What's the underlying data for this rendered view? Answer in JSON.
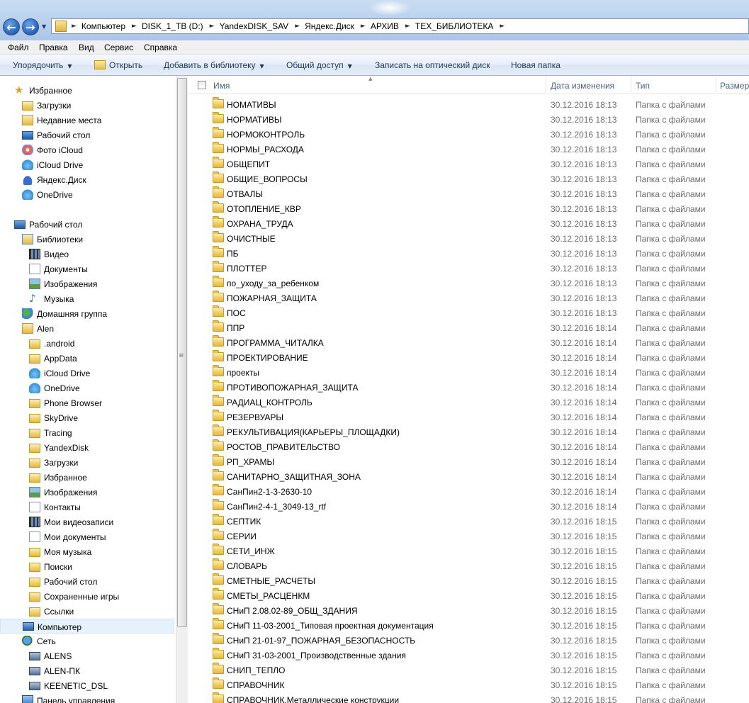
{
  "breadcrumb": [
    "Компьютер",
    "DISK_1_TB (D:)",
    "YandexDISK_SAV",
    "Яндекс.Диск",
    "АРХИВ",
    "ТЕХ_БИБЛИОТЕКА"
  ],
  "menu": [
    "Файл",
    "Правка",
    "Вид",
    "Сервис",
    "Справка"
  ],
  "toolbar": {
    "organize": "Упорядочить",
    "open": "Открыть",
    "add_to_library": "Добавить в библиотеку",
    "share": "Общий доступ",
    "burn": "Записать на оптический диск",
    "new_folder": "Новая папка"
  },
  "nav": [
    {
      "label": "Избранное",
      "icon": "star-icon"
    },
    {
      "label": "Загрузки",
      "icon": "downloads-folder-icon"
    },
    {
      "label": "Недавние места",
      "icon": "recent-places-icon"
    },
    {
      "label": "Рабочий стол",
      "icon": "desktop-icon"
    },
    {
      "label": "Фото iCloud",
      "icon": "icloud-photos-icon"
    },
    {
      "label": "iCloud Drive",
      "icon": "icloud-drive-icon"
    },
    {
      "label": "Яндекс.Диск",
      "icon": "yandex-disk-icon"
    },
    {
      "label": "OneDrive",
      "icon": "onedrive-icon"
    },
    {
      "label": "Рабочий стол",
      "icon": "desktop-icon"
    },
    {
      "label": "Библиотеки",
      "icon": "libraries-icon"
    },
    {
      "label": "Видео",
      "icon": "video-icon"
    },
    {
      "label": "Документы",
      "icon": "documents-icon"
    },
    {
      "label": "Изображения",
      "icon": "pictures-icon"
    },
    {
      "label": "Музыка",
      "icon": "music-icon"
    },
    {
      "label": "Домашняя группа",
      "icon": "homegroup-icon"
    },
    {
      "label": "Alen",
      "icon": "user-folder-icon"
    },
    {
      "label": ".android",
      "icon": "folder-icon"
    },
    {
      "label": "AppData",
      "icon": "folder-icon"
    },
    {
      "label": "iCloud Drive",
      "icon": "icloud-drive-icon"
    },
    {
      "label": "OneDrive",
      "icon": "onedrive-icon"
    },
    {
      "label": "Phone Browser",
      "icon": "folder-icon"
    },
    {
      "label": "SkyDrive",
      "icon": "folder-icon"
    },
    {
      "label": "Tracing",
      "icon": "folder-icon"
    },
    {
      "label": "YandexDisk",
      "icon": "folder-icon"
    },
    {
      "label": "Загрузки",
      "icon": "downloads-folder-icon"
    },
    {
      "label": "Избранное",
      "icon": "favorites-folder-icon"
    },
    {
      "label": "Изображения",
      "icon": "pictures-icon"
    },
    {
      "label": "Контакты",
      "icon": "contacts-icon"
    },
    {
      "label": "Мои видеозаписи",
      "icon": "video-icon"
    },
    {
      "label": "Мои документы",
      "icon": "documents-icon"
    },
    {
      "label": "Моя музыка",
      "icon": "music-folder-icon"
    },
    {
      "label": "Поиски",
      "icon": "searches-icon"
    },
    {
      "label": "Рабочий стол",
      "icon": "desktop-folder-icon"
    },
    {
      "label": "Сохраненные игры",
      "icon": "saved-games-icon"
    },
    {
      "label": "Ссылки",
      "icon": "links-icon"
    },
    {
      "label": "Компьютер",
      "icon": "computer-icon"
    },
    {
      "label": "Сеть",
      "icon": "network-icon"
    },
    {
      "label": "ALENS",
      "icon": "network-computer-icon"
    },
    {
      "label": "ALEN-ПК",
      "icon": "network-computer-icon"
    },
    {
      "label": "KEENETIC_DSL",
      "icon": "network-computer-icon"
    },
    {
      "label": "Панель управления",
      "icon": "control-panel-icon"
    }
  ],
  "columns": {
    "name": "Имя",
    "date": "Дата изменения",
    "type": "Тип",
    "size": "Размер"
  },
  "files": [
    {
      "name": "НОМАТИВЫ",
      "date": "30.12.2016 18:13",
      "type": "Папка с файлами"
    },
    {
      "name": "НОРМАТИВЫ",
      "date": "30.12.2016 18:13",
      "type": "Папка с файлами"
    },
    {
      "name": "НОРМОКОНТРОЛЬ",
      "date": "30.12.2016 18:13",
      "type": "Папка с файлами"
    },
    {
      "name": "НОРМЫ_РАСХОДА",
      "date": "30.12.2016 18:13",
      "type": "Папка с файлами"
    },
    {
      "name": "ОБЩЕПИТ",
      "date": "30.12.2016 18:13",
      "type": "Папка с файлами"
    },
    {
      "name": "ОБЩИЕ_ВОПРОСЫ",
      "date": "30.12.2016 18:13",
      "type": "Папка с файлами"
    },
    {
      "name": "ОТВАЛЫ",
      "date": "30.12.2016 18:13",
      "type": "Папка с файлами"
    },
    {
      "name": "ОТОПЛЕНИЕ_КВР",
      "date": "30.12.2016 18:13",
      "type": "Папка с файлами"
    },
    {
      "name": "ОХРАНА_ТРУДА",
      "date": "30.12.2016 18:13",
      "type": "Папка с файлами"
    },
    {
      "name": "ОЧИСТНЫЕ",
      "date": "30.12.2016 18:13",
      "type": "Папка с файлами"
    },
    {
      "name": "ПБ",
      "date": "30.12.2016 18:13",
      "type": "Папка с файлами"
    },
    {
      "name": "ПЛОТТЕР",
      "date": "30.12.2016 18:13",
      "type": "Папка с файлами"
    },
    {
      "name": "по_уходу_за_ребенком",
      "date": "30.12.2016 18:13",
      "type": "Папка с файлами"
    },
    {
      "name": "ПОЖАРНАЯ_ЗАЩИТА",
      "date": "30.12.2016 18:13",
      "type": "Папка с файлами"
    },
    {
      "name": "ПОС",
      "date": "30.12.2016 18:13",
      "type": "Папка с файлами"
    },
    {
      "name": "ППР",
      "date": "30.12.2016 18:14",
      "type": "Папка с файлами"
    },
    {
      "name": "ПРОГРАММА_ЧИТАЛКА",
      "date": "30.12.2016 18:14",
      "type": "Папка с файлами"
    },
    {
      "name": "ПРОЕКТИРОВАНИЕ",
      "date": "30.12.2016 18:14",
      "type": "Папка с файлами"
    },
    {
      "name": "проекты",
      "date": "30.12.2016 18:14",
      "type": "Папка с файлами"
    },
    {
      "name": "ПРОТИВОПОЖАРНАЯ_ЗАЩИТА",
      "date": "30.12.2016 18:14",
      "type": "Папка с файлами"
    },
    {
      "name": "РАДИАЦ_КОНТРОЛЬ",
      "date": "30.12.2016 18:14",
      "type": "Папка с файлами"
    },
    {
      "name": "РЕЗЕРВУАРЫ",
      "date": "30.12.2016 18:14",
      "type": "Папка с файлами"
    },
    {
      "name": "РЕКУЛЬТИВАЦИЯ(КАРЬЕРЫ_ПЛОЩАДКИ)",
      "date": "30.12.2016 18:14",
      "type": "Папка с файлами"
    },
    {
      "name": "РОСТОВ_ПРАВИТЕЛЬСТВО",
      "date": "30.12.2016 18:14",
      "type": "Папка с файлами"
    },
    {
      "name": "РП_ХРАМЫ",
      "date": "30.12.2016 18:14",
      "type": "Папка с файлами"
    },
    {
      "name": "САНИТАРНО_ЗАЩИТНАЯ_ЗОНА",
      "date": "30.12.2016 18:14",
      "type": "Папка с файлами"
    },
    {
      "name": "СанПин2-1-3-2630-10",
      "date": "30.12.2016 18:14",
      "type": "Папка с файлами"
    },
    {
      "name": "СанПин2-4-1_3049-13_rtf",
      "date": "30.12.2016 18:14",
      "type": "Папка с файлами"
    },
    {
      "name": "СЕПТИК",
      "date": "30.12.2016 18:15",
      "type": "Папка с файлами"
    },
    {
      "name": "СЕРИИ",
      "date": "30.12.2016 18:15",
      "type": "Папка с файлами"
    },
    {
      "name": "СЕТИ_ИНЖ",
      "date": "30.12.2016 18:15",
      "type": "Папка с файлами"
    },
    {
      "name": "СЛОВАРЬ",
      "date": "30.12.2016 18:15",
      "type": "Папка с файлами"
    },
    {
      "name": "СМЕТНЫЕ_РАСЧЕТЫ",
      "date": "30.12.2016 18:15",
      "type": "Папка с файлами"
    },
    {
      "name": "СМЕТЫ_РАСЦЕНКМ",
      "date": "30.12.2016 18:15",
      "type": "Папка с файлами"
    },
    {
      "name": "СНиП 2.08.02-89_ОБЩ_ЗДАНИЯ",
      "date": "30.12.2016 18:15",
      "type": "Папка с файлами"
    },
    {
      "name": "СНиП 11-03-2001_Типовая проектная документация",
      "date": "30.12.2016 18:15",
      "type": "Папка с файлами"
    },
    {
      "name": "СНиП 21-01-97_ПОЖАРНАЯ_БЕЗОПАСНОСТЬ",
      "date": "30.12.2016 18:15",
      "type": "Папка с файлами"
    },
    {
      "name": "СНиП 31-03-2001_Производственные здания",
      "date": "30.12.2016 18:15",
      "type": "Папка с файлами"
    },
    {
      "name": "СНИП_ТЕПЛО",
      "date": "30.12.2016 18:15",
      "type": "Папка с файлами"
    },
    {
      "name": "СПРАВОЧНИК",
      "date": "30.12.2016 18:15",
      "type": "Папка с файлами"
    },
    {
      "name": "СПРАВОЧНИК.Металлические конструкции",
      "date": "30.12.2016 18:15",
      "type": "Папка с файлами"
    }
  ]
}
